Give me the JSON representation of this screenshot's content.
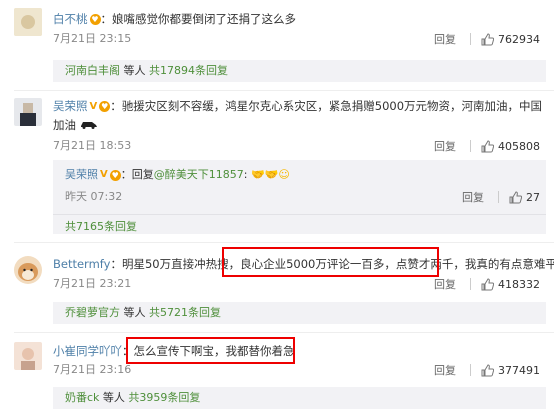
{
  "comments": [
    {
      "user": "白不桃",
      "text": "：娘嘴感觉你都要倒闭了还捐了这么多",
      "time": "7月21日 23:15",
      "reply_label": "回复",
      "likes": "762934",
      "sub": {
        "user": "河南白丰阁",
        "text": "等人",
        "count_text": "共17894条回复"
      }
    },
    {
      "user": "吴荣照",
      "text": "：驰援灾区刻不容缓，鸿星尔克心系灾区，紧急捐赠5000万元物资，河南加油，中国",
      "text2": "加油",
      "time": "7月21日 18:53",
      "reply_label": "回复",
      "likes": "405808",
      "nested": {
        "user": "吴荣照",
        "text": "：回复",
        "mention": "@醉美天下11857",
        "tail": ":",
        "time": "昨天 07:32",
        "reply_label": "回复",
        "likes": "27"
      },
      "sub": {
        "text": "",
        "count_text": "共7165条回复"
      }
    },
    {
      "user": "Bettermfy",
      "text_pre": "：明星50万直接冲热搜，",
      "text_hl": "良心企业5000万评论一百多，点赞才两千，",
      "text_post": "我真的有点意难平",
      "time": "7月21日 23:21",
      "reply_label": "回复",
      "likes": "418332",
      "sub": {
        "user": "乔碧萝官方",
        "text": "等人",
        "count_text": "共5721条回复"
      }
    },
    {
      "user": "小崔同学吖吖",
      "text_pre": "：",
      "text_hl": "怎么宣传下啊宝，我都替你着急",
      "time": "7月21日 23:16",
      "reply_label": "回复",
      "likes": "377491",
      "sub": {
        "user": "奶番ck",
        "text": "等人",
        "count_text": "共3959条回复"
      }
    }
  ]
}
